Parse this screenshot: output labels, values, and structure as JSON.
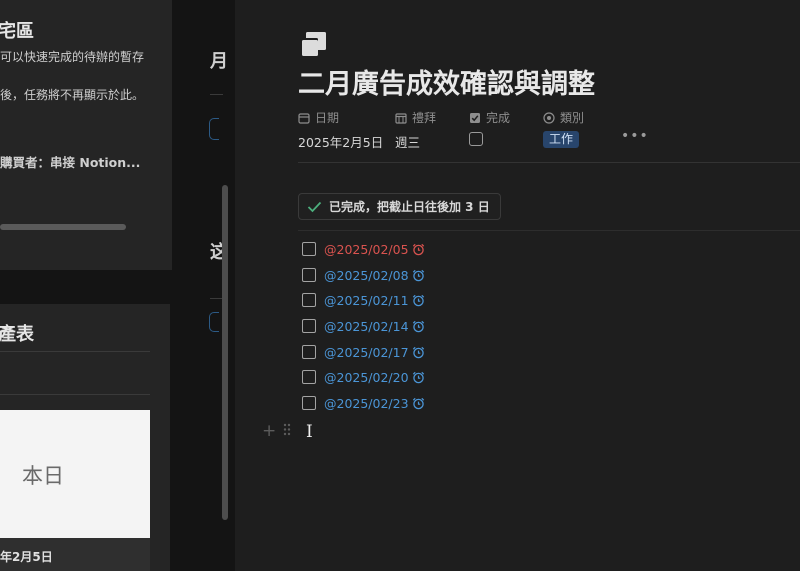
{
  "sidebar_panel": {
    "top_card": {
      "title": "宅區",
      "desc_line1": "可以快速完成的待辦的暫存",
      "desc_line2": "後，任務將不再顯示於此。",
      "item_label": "購買者：串接 Notion..."
    },
    "bottom_card": {
      "title": "產表",
      "calendar_day": "本日",
      "calendar_date": "年2月5日"
    },
    "middle_fragments": [
      "月",
      "这"
    ]
  },
  "page": {
    "icon": "copy-stack-icon",
    "title": "二月廣告成效確認與調整",
    "properties": [
      {
        "label": "日期",
        "icon": "calendar-icon",
        "value": "2025年2月5日"
      },
      {
        "label": "禮拜",
        "icon": "week-icon",
        "value": "週三"
      },
      {
        "label": "完成",
        "icon": "checkbox-icon",
        "value": ""
      },
      {
        "label": "類別",
        "icon": "select-icon",
        "value": "工作"
      }
    ],
    "more_label": "•••",
    "callout": {
      "icon": "checkmark-icon",
      "text": "已完成，把截止日往後加 3 日"
    },
    "todos": [
      {
        "date": "@2025/02/05",
        "overdue": true
      },
      {
        "date": "@2025/02/08",
        "overdue": false
      },
      {
        "date": "@2025/02/11",
        "overdue": false
      },
      {
        "date": "@2025/02/14",
        "overdue": false
      },
      {
        "date": "@2025/02/17",
        "overdue": false
      },
      {
        "date": "@2025/02/20",
        "overdue": false
      },
      {
        "date": "@2025/02/23",
        "overdue": false
      }
    ],
    "block_add_label": "+",
    "text_cursor": "I"
  },
  "colors": {
    "background": "#191919",
    "link_blue": "#4b95d6",
    "overdue_red": "#d9534f",
    "tag_bg": "#28456c",
    "callout_check": "#4caf7d"
  }
}
